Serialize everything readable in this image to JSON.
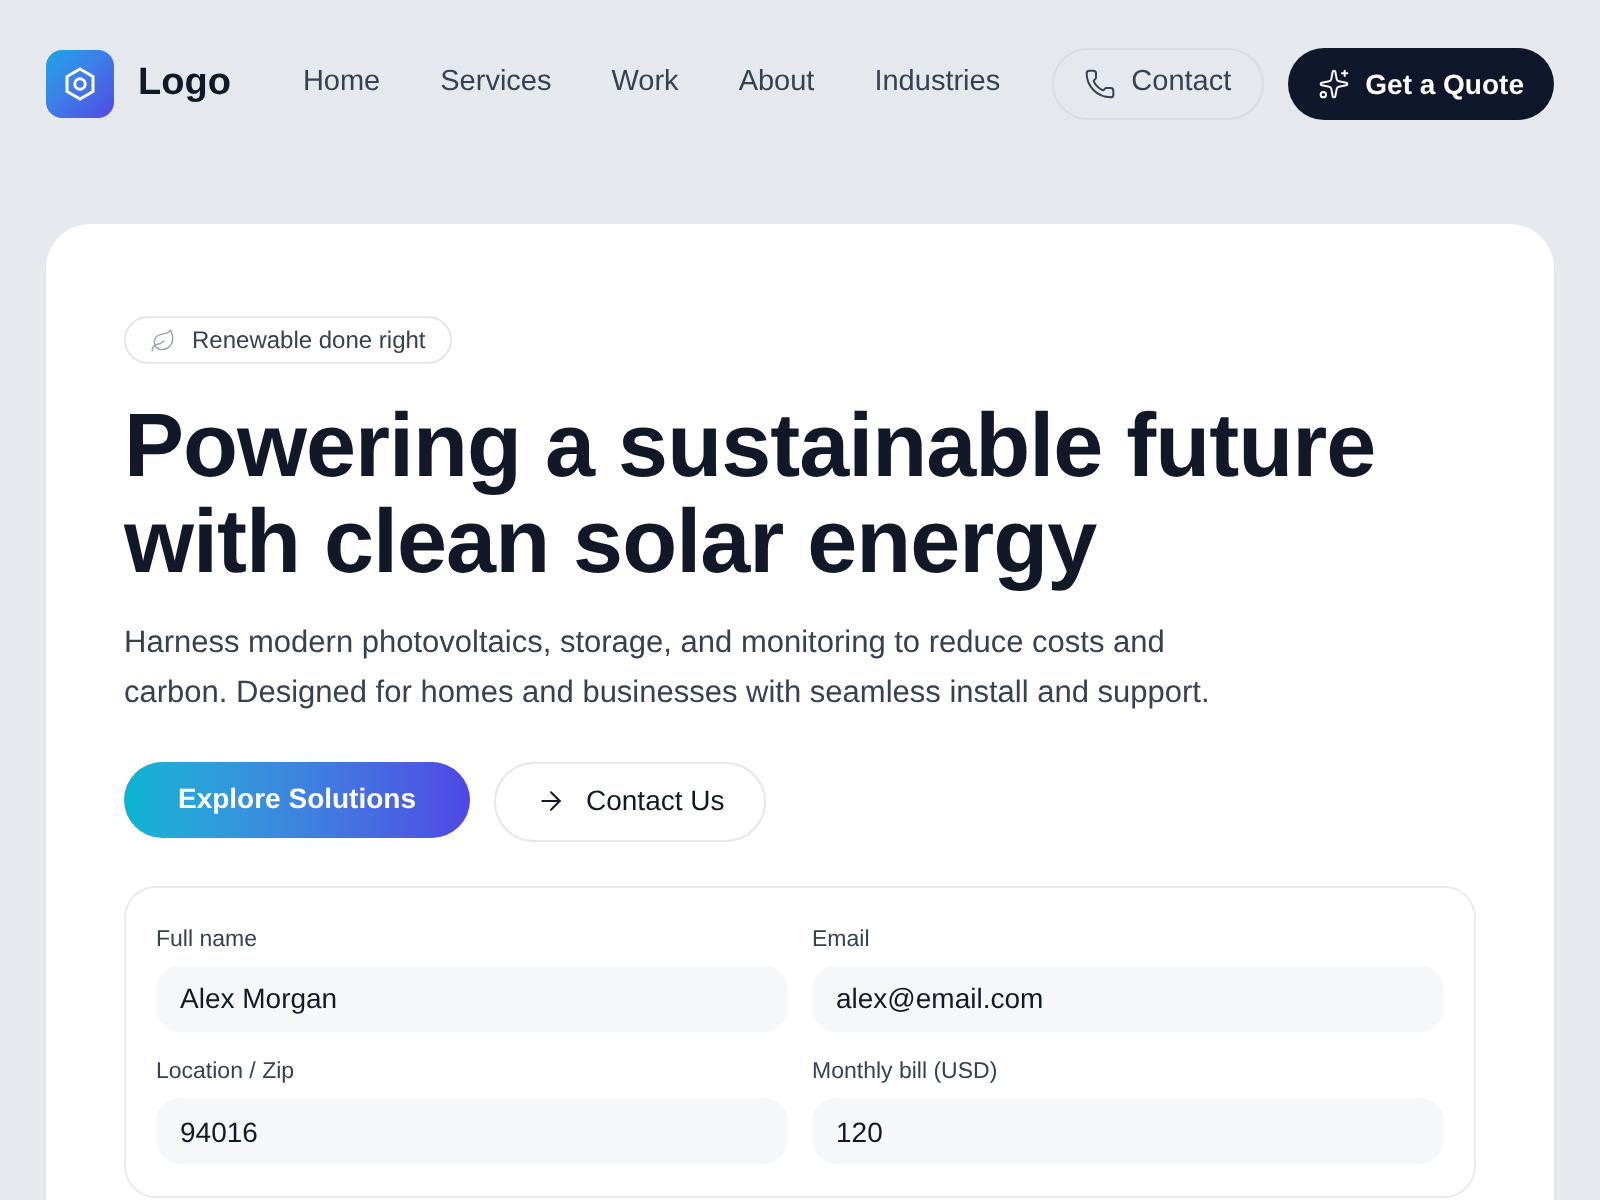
{
  "brand": {
    "name": "Logo"
  },
  "nav": [
    {
      "label": "Home"
    },
    {
      "label": "Services"
    },
    {
      "label": "Work"
    },
    {
      "label": "About"
    },
    {
      "label": "Industries"
    }
  ],
  "header_buttons": {
    "contact": "Contact",
    "quote": "Get a Quote"
  },
  "hero": {
    "badge": "Renewable done right",
    "title_lines": [
      "Powering a sustainable future",
      "with clean solar energy"
    ],
    "description": "Harness modern photovoltaics, storage, and monitoring to reduce costs and carbon. Designed for homes and businesses with seamless install and support.",
    "primary_button": "Explore Solutions",
    "secondary_button": "Contact Us"
  },
  "form": {
    "fields": [
      {
        "label": "Full name",
        "value": "Alex Morgan"
      },
      {
        "label": "Email",
        "value": "alex@email.com"
      },
      {
        "label": "Location / Zip",
        "value": "94016"
      },
      {
        "label": "Monthly bill (USD)",
        "value": "120"
      }
    ]
  }
}
